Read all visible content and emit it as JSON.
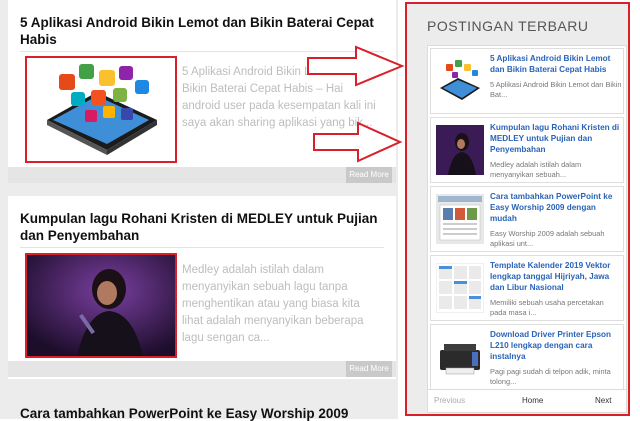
{
  "posts": [
    {
      "title": "5 Aplikasi Android Bikin Lemot dan Bikin Baterai Cepat Habis",
      "excerpt": "5 Aplikasi Android Bikin Lemot dan Bikin Baterai Cepat Habis – Hai android user pada kesempatan kali ini saya akan sharing aplikasi yang bik...",
      "read_more": "Read More"
    },
    {
      "title": "Kumpulan lagu Rohani Kristen di MEDLEY untuk Pujian dan Penyembahan",
      "excerpt": "Medley adalah istilah dalam menyanyikan sebuah lagu tanpa menghentikan atau yang biasa kita lihat adalah menyanyikan beberapa lagu sengan ca...",
      "read_more": "Read More"
    },
    {
      "title": "Cara tambahkan PowerPoint ke Easy Worship 2009"
    }
  ],
  "sidebar": {
    "title": "POSTINGAN TERBARU",
    "items": [
      {
        "title": "5 Aplikasi Android Bikin Lemot dan Bikin Baterai Cepat Habis",
        "excerpt": "5 Aplikasi Android Bikin Lemot dan Bikin Bat..."
      },
      {
        "title": "Kumpulan lagu Rohani Kristen di MEDLEY untuk Pujian dan Penyembahan",
        "excerpt": "Medley adalah istilah dalam menyanyikan sebuah..."
      },
      {
        "title": "Cara tambahkan PowerPoint ke Easy Worship 2009 dengan mudah",
        "excerpt": "Easy Worship 2009 adalah sebuah aplikasi unt..."
      },
      {
        "title": "Template Kalender 2019 Vektor lengkap tanggal Hijriyah, Jawa dan Libur Nasional",
        "excerpt": "Memiliki sebuah usaha percetakan pada masa i..."
      },
      {
        "title": "Download Driver Printer Epson L210 lengkap dengan cara instalnya",
        "excerpt": "Pagi pagi sudah di telpon adik, minta tolong..."
      }
    ],
    "pager": {
      "previous": "Previous",
      "home": "Home",
      "next": "Next"
    }
  },
  "colors": {
    "annotation_red": "#d9202a",
    "link_blue": "#2a64b8"
  }
}
